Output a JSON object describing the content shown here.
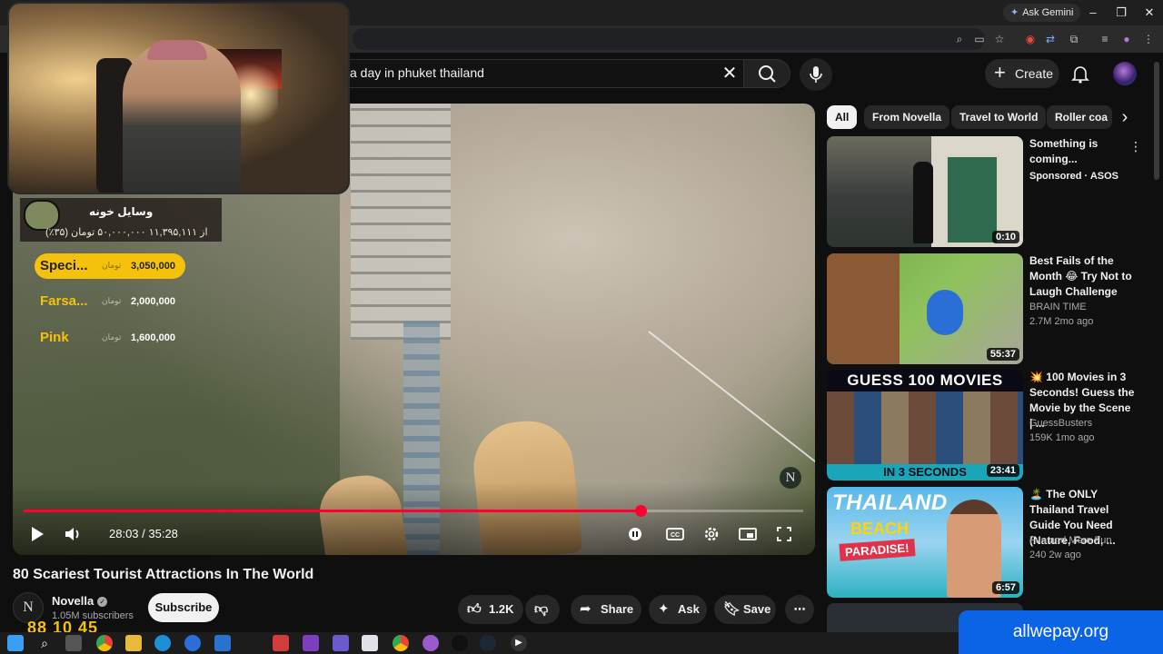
{
  "browser": {
    "ask_gemini": "Ask Gemini",
    "window_controls": [
      "–",
      "❐",
      "✕"
    ]
  },
  "youtube": {
    "search_query": "a day in  phuket thailand",
    "create_label": "Create"
  },
  "player": {
    "current_time": "28:03",
    "duration": "35:28",
    "time_label": "28:03 / 35:28",
    "progress_fraction": 0.791,
    "watermark": "N",
    "accent_color": "#ff0033"
  },
  "overlay": {
    "donation_title": "وسایل خونه",
    "donation_progress": "از ۱۱,۳۹۵,۱۱۱ ۵۰,۰۰۰,۰۰۰ تومان (۳۵٪)",
    "leaderboard": [
      {
        "name": "Speci...",
        "amount": "3,050,000",
        "unit": "تومان"
      },
      {
        "name": "Farsa...",
        "amount": "2,000,000",
        "unit": "تومان"
      },
      {
        "name": "Pink",
        "amount": "1,600,000",
        "unit": "تومان"
      }
    ],
    "clock": "88 10 45"
  },
  "video": {
    "title": "80 Scariest Tourist Attractions In The World",
    "channel": "Novella",
    "channel_initial": "N",
    "subscribers": "1.05M subscribers",
    "subscribe_label": "Subscribe",
    "likes": "1.2K",
    "share_label": "Share",
    "ask_label": "Ask",
    "save_label": "Save"
  },
  "chips": [
    "All",
    "From Novella",
    "Travel to World",
    "Roller coa"
  ],
  "recommendations": [
    {
      "title": "Something is coming...",
      "meta1": "Sponsored · ASOS",
      "meta2": "",
      "duration": "0:10"
    },
    {
      "title": "Best Fails of the Month 😂 Try Not to Laugh Challenge",
      "meta1": "BRAIN TIME",
      "meta2": "2.7M  2mo ago",
      "duration": "55:37"
    },
    {
      "title": "💥 100 Movies in 3 Seconds! Guess the Movie by the Scene | ...",
      "meta1": "GuessBusters",
      "meta2": "159K  1mo ago",
      "duration": "23:41",
      "thumb_head": "GUESS 100 MOVIES",
      "thumb_foot": "IN 3 SECONDS"
    },
    {
      "title": "🏝️ The ONLY Thailand Travel Guide You Need (Nature, Food, ...",
      "meta1": "Fun and More Fun",
      "meta2": "240  2w ago",
      "duration": "6:57",
      "thumb_line1": "THAILAND",
      "thumb_line2": "BEACH",
      "thumb_tag": "PARADISE!"
    }
  ],
  "banner": "allwepay.org"
}
